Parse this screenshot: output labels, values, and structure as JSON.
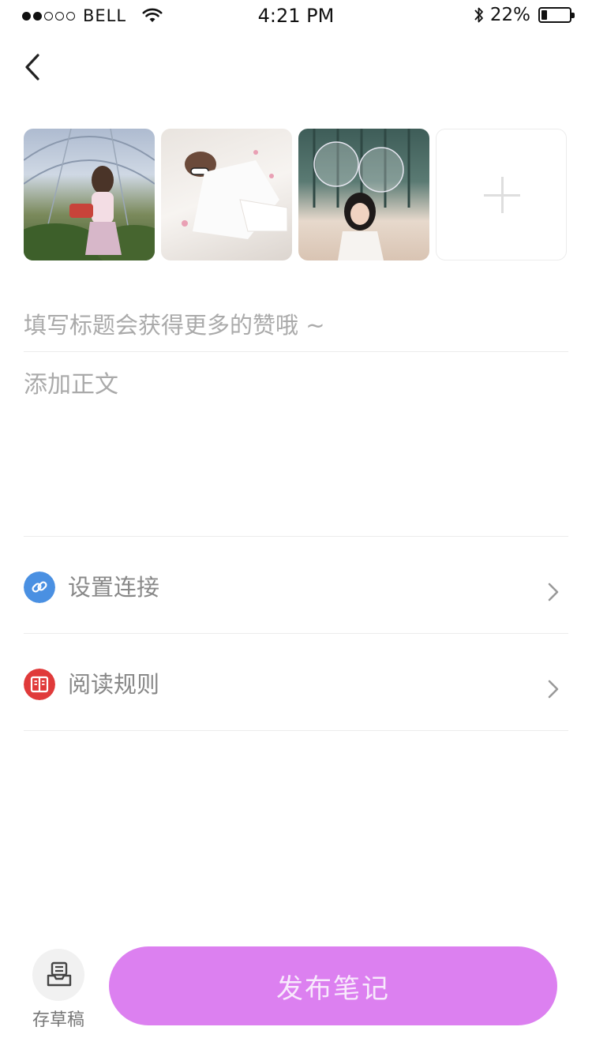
{
  "status_bar": {
    "carrier": "BELL",
    "time": "4:21 PM",
    "battery_percent": "22%",
    "battery_level": 0.22,
    "signal_bars_filled": 2,
    "signal_bars_total": 5,
    "icons": [
      "wifi-icon",
      "bluetooth-icon",
      "battery-icon"
    ]
  },
  "nav": {
    "back_icon": "chevron-left-icon"
  },
  "photos": {
    "items": [
      {
        "name": "photo-thumbnail-1"
      },
      {
        "name": "photo-thumbnail-2"
      },
      {
        "name": "photo-thumbnail-3"
      }
    ],
    "add_icon": "plus-icon"
  },
  "form": {
    "title_placeholder": "填写标题会获得更多的赞哦 ~",
    "title_value": "",
    "body_placeholder": "添加正文",
    "body_value": ""
  },
  "options": [
    {
      "label": "设置连接",
      "icon": "link-icon",
      "color": "#4a90e2"
    },
    {
      "label": "阅读规则",
      "icon": "book-icon",
      "color": "#e03a3a"
    }
  ],
  "footer": {
    "draft_label": "存草稿",
    "draft_icon": "inbox-icon",
    "publish_label": "发布笔记",
    "publish_color": "#dc80f0"
  }
}
